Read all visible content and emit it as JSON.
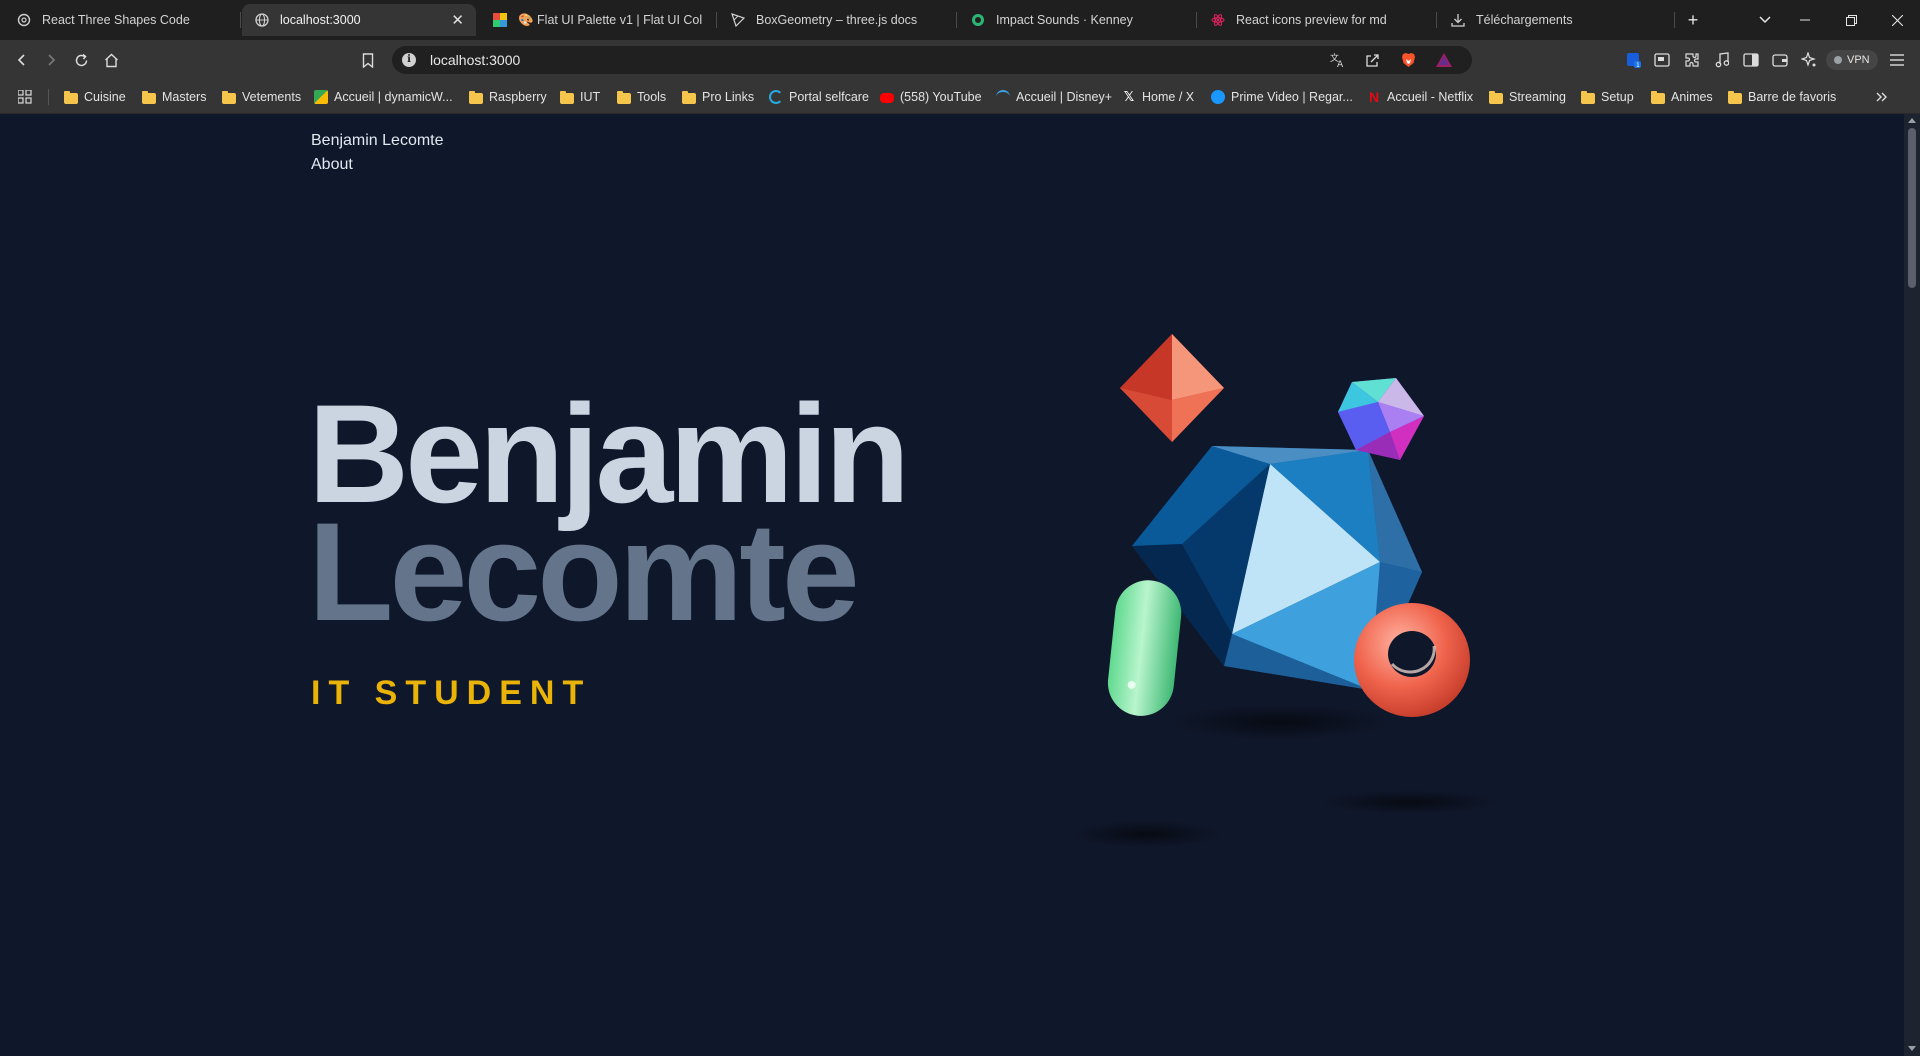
{
  "browser": {
    "tabs": [
      {
        "label": "React Three Shapes Code",
        "icon": "openai-icon",
        "active": false
      },
      {
        "label": "localhost:3000",
        "icon": "globe-icon",
        "active": true
      },
      {
        "label": "🎨 Flat UI Palette v1 | Flat UI Colors",
        "icon": "flat-ui-icon",
        "active": false
      },
      {
        "label": "BoxGeometry – three.js docs",
        "icon": "threejs-icon",
        "active": false
      },
      {
        "label": "Impact Sounds · Kenney",
        "icon": "kenney-icon",
        "active": false
      },
      {
        "label": "React icons preview for md",
        "icon": "react-icon",
        "active": false
      },
      {
        "label": "Téléchargements",
        "icon": "download-icon",
        "active": false
      }
    ],
    "window_controls": [
      "new-tab",
      "tab-search",
      "minimize",
      "restore",
      "close"
    ],
    "address": {
      "url": "localhost:3000"
    },
    "vpn_label": "VPN",
    "bookmarks": [
      {
        "label": "Cuisine",
        "icon": "folder-icon"
      },
      {
        "label": "Masters",
        "icon": "folder-icon"
      },
      {
        "label": "Vetements",
        "icon": "folder-icon"
      },
      {
        "label": "Accueil | dynamicW...",
        "icon": "map-icon"
      },
      {
        "label": "Raspberry",
        "icon": "folder-icon"
      },
      {
        "label": "IUT",
        "icon": "folder-icon"
      },
      {
        "label": "Tools",
        "icon": "folder-icon"
      },
      {
        "label": "Pro Links",
        "icon": "folder-icon"
      },
      {
        "label": "Portal selfcare",
        "icon": "portal-icon"
      },
      {
        "label": "(558) YouTube",
        "icon": "youtube-icon"
      },
      {
        "label": "Accueil | Disney+",
        "icon": "disney-icon"
      },
      {
        "label": "Home / X",
        "icon": "x-icon"
      },
      {
        "label": "Prime Video | Regar...",
        "icon": "prime-video-icon"
      },
      {
        "label": "Accueil - Netflix",
        "icon": "netflix-icon"
      },
      {
        "label": "Streaming",
        "icon": "folder-icon"
      },
      {
        "label": "Setup",
        "icon": "folder-icon"
      },
      {
        "label": "Animes",
        "icon": "folder-icon"
      },
      {
        "label": "Barre de favoris",
        "icon": "folder-icon"
      }
    ]
  },
  "site": {
    "nav": {
      "name": "Benjamin Lecomte",
      "about": "About"
    },
    "hero": {
      "first_name": "Benjamin",
      "last_name": "Lecomte",
      "subtitle": "IT STUDENT"
    },
    "colors": {
      "background": "#0f172a",
      "first_name": "#cbd5e1",
      "last_name": "#64748b",
      "subtitle": "#eab308"
    }
  }
}
